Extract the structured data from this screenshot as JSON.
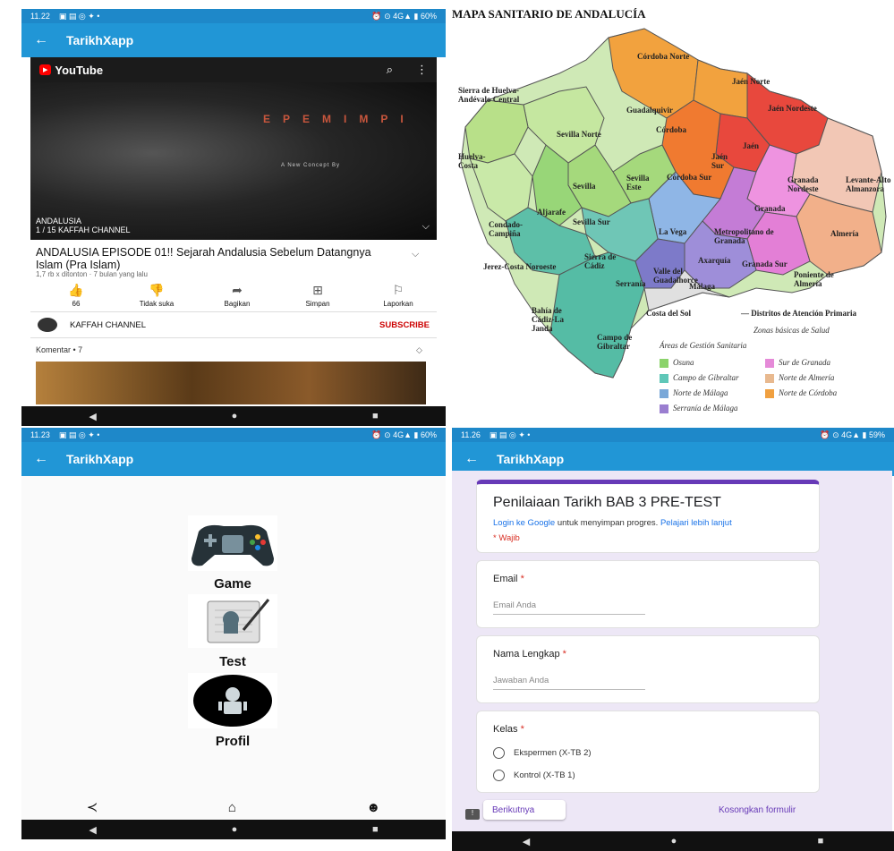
{
  "status": {
    "top_left": {
      "time": "11.22",
      "right": "⏰ ⊙ 4G▲ ▮ 60%"
    },
    "bottom_left": {
      "time": "11.23",
      "right": "⏰ ⊙ 4G▲ ▮ 60%"
    },
    "bottom_right": {
      "time": "11.26",
      "right": "⏰ ⊙ 4G▲ ▮ 59%"
    }
  },
  "app": {
    "title": "TarikhXapp",
    "back": "←"
  },
  "youtube": {
    "logo": "YouTube",
    "banner": "EPEMIMPI",
    "concept": "A New Concept By",
    "playlist_name": "ANDALUSIA",
    "playlist_pos": "1 / 15  KAFFAH CHANNEL",
    "title": "ANDALUSIA EPISODE 01!! Sejarah Andalusia Sebelum Datangnya Islam (Pra Islam)",
    "meta": "1,7 rb x ditonton · 7 bulan yang lalu",
    "actions": [
      {
        "icon": "👍",
        "label": "66"
      },
      {
        "icon": "👎",
        "label": "Tidak suka"
      },
      {
        "icon": "➦",
        "label": "Bagikan"
      },
      {
        "icon": "⊞",
        "label": "Simpan"
      },
      {
        "icon": "⚐",
        "label": "Laporkan"
      }
    ],
    "channel": "KAFFAH CHANNEL",
    "subscribe": "SUBSCRIBE",
    "comments": "Komentar • 7"
  },
  "map": {
    "title": "MAPA SANITARIO DE ANDALUCÍA",
    "regions": [
      "Córdoba Norte",
      "Jaén Norte",
      "Sierra de Huelva-Andévalo Central",
      "Guadalquivir",
      "Jaén Nordeste",
      "Sevilla Norte",
      "Córdoba",
      "Jaén",
      "Huelva-Costa",
      "Jaén Sur",
      "Sevilla",
      "Sevilla Este",
      "Córdoba Sur",
      "Granada Nordeste",
      "Levante-Alto Almanzora",
      "Aljarafe",
      "Granada",
      "Condado-Campiña",
      "Sevilla Sur",
      "La Vega",
      "Metropolitano de Granada",
      "Almería",
      "Sierra de Cádiz",
      "Jerez-Costa Noroeste",
      "Axarquía",
      "Granada Sur",
      "Poniente de Almería",
      "Valle del Guadalhorce",
      "Málaga",
      "Serranía",
      "Bahía de Cádiz-La Janda",
      "Costa del Sol",
      "Campo de Gibraltar"
    ],
    "primary_care": "— Distritos de Atención Primaria",
    "zones": "Zonas básicas de Salud",
    "legend_title": "Áreas de Gestión Sanitaria",
    "legend": [
      {
        "label": "Osuna",
        "color": "#8bd36b"
      },
      {
        "label": "Sur de Granada",
        "color": "#e58ad8"
      },
      {
        "label": "Campo de Gibraltar",
        "color": "#5fc7b8"
      },
      {
        "label": "Norte de Almería",
        "color": "#e8b98f"
      },
      {
        "label": "Norte de Málaga",
        "color": "#7aa8d8"
      },
      {
        "label": "Norte de Córdoba",
        "color": "#f0a040"
      },
      {
        "label": "Serranía de Málaga",
        "color": "#9a7ed0"
      }
    ]
  },
  "menu": {
    "items": [
      {
        "label": "Game"
      },
      {
        "label": "Test"
      },
      {
        "label": "Profil"
      }
    ]
  },
  "form": {
    "title": "Penilaiaan Tarikh BAB 3 PRE-TEST",
    "login_link": "Login ke Google",
    "login_rest": " untuk menyimpan progres. ",
    "learn_more": "Pelajari lebih lanjut",
    "required_note": "* Wajib",
    "email_label": "Email",
    "email_placeholder": "Email Anda",
    "name_label": "Nama Lengkap",
    "name_placeholder": "Jawaban Anda",
    "class_label": "Kelas",
    "options": [
      "Ekspermen (X-TB 2)",
      "Kontrol (X-TB 1)"
    ],
    "next_button": "Berikutnya",
    "clear_button": "Kosongkan formulir"
  },
  "colors": {
    "appbar": "#2196d6",
    "accent": "#673ab7",
    "subscribe": "#cc0000"
  }
}
